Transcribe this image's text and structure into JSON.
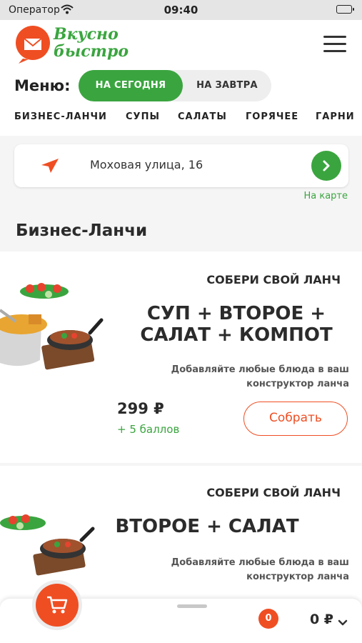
{
  "status_bar": {
    "carrier": "Оператор",
    "time": "09:40"
  },
  "header": {
    "logo_line1": "Вкусно",
    "logo_line2": "быстро",
    "menu_label": "Меню:",
    "day_tabs": [
      {
        "label": "НА СЕГОДНЯ",
        "active": true
      },
      {
        "label": "НА ЗАВТРА",
        "active": false
      }
    ],
    "categories": [
      "БИЗНЕС-ЛАНЧИ",
      "СУПЫ",
      "САЛАТЫ",
      "ГОРЯЧЕЕ",
      "ГАРНИ"
    ]
  },
  "address": {
    "value": "Моховая улица, 16",
    "map_link": "На карте"
  },
  "section_title": "Бизнес-Ланчи",
  "cards": [
    {
      "kicker": "СОБЕРИ СВОЙ ЛАНЧ",
      "combo_line1": "СУП + ВТОРОЕ +",
      "combo_line2": "САЛАТ + КОМПОТ",
      "hint_line1": "Добавляйте любые блюда в ваш",
      "hint_line2": "конструктор ланча",
      "price": "299 ₽",
      "points": "+ 5 баллов",
      "button": "Собрать"
    },
    {
      "kicker": "СОБЕРИ СВОЙ ЛАНЧ",
      "combo_line1": "ВТОРОЕ + САЛАТ",
      "hint_line1": "Добавляйте любые блюда в ваш",
      "hint_line2": "конструктор ланча"
    }
  ],
  "cart": {
    "count": "0",
    "total": "0 ₽"
  },
  "colors": {
    "brand_green": "#3aa53f",
    "brand_orange": "#ef4e23"
  },
  "icons": [
    "wifi-icon",
    "battery-icon",
    "logo-icon",
    "hamburger-icon",
    "navigation-arrow-icon",
    "chevron-right-icon",
    "cart-icon",
    "chevron-down-icon"
  ]
}
